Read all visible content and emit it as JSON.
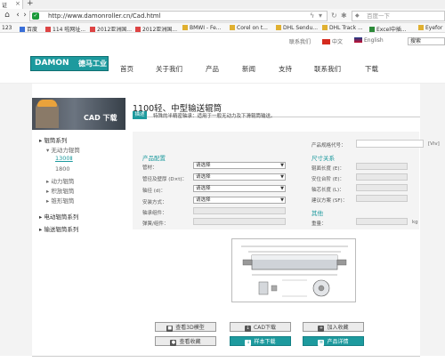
{
  "browser": {
    "tab_title": "证",
    "tab_close": "×",
    "new_tab": "+",
    "url": "http://www.damonroller.cn/Cad.html",
    "search_placeholder": "百度一下",
    "bookmarks": [
      "123",
      "百度",
      "114 啦网址...",
      "2012亚洲国...",
      "2012亚洲国...",
      "BMWI - Fe...",
      "Corel on t...",
      "DHL Sendu...",
      "DHL Track ...",
      "Excel中插...",
      "Eyefor"
    ]
  },
  "site": {
    "top_links": {
      "favorite": "联系我们",
      "cn": "中文",
      "en": "English",
      "search": "搜索"
    },
    "logo_text": "DAMON",
    "logo_cn": "德马工业",
    "menu": [
      "首页",
      "关于我们",
      "产品",
      "新闻",
      "支持",
      "联系我们",
      "下载"
    ]
  },
  "sidebar": {
    "banner": "CAD 下载",
    "items": [
      {
        "label": "辊筒系列"
      },
      {
        "label": "无动力辊筒"
      },
      {
        "label": "1300Ⅱ"
      },
      {
        "label": "1800"
      },
      {
        "label": "动力辊筒"
      },
      {
        "label": "积放辊筒"
      },
      {
        "label": "锥形辊筒"
      },
      {
        "label": "电动辊筒系列"
      },
      {
        "label": "输送辊筒系列"
      }
    ]
  },
  "product": {
    "title": "1100轻、中型输送辊筒",
    "tag": "描述",
    "feature": "特殊的半精密轴承：适用于一般无动力及下滑辊筒输送。",
    "config_title": "产品配置",
    "size_title": "尺寸关系",
    "other_title": "其他",
    "model_label": "产品规格代号：",
    "model_unit": "[Viv]",
    "left_fields": [
      "管材：",
      "管径及壁厚 (D×t)：",
      "轴径 (d)：",
      "安装方式："
    ],
    "select_value": "请选择",
    "left_inputs": [
      "轴承组件：",
      "弹簧/组件："
    ],
    "right_fields": [
      "辊面长度 (E)：",
      "安位台阶 (E)：",
      "轴芯长度 (L)：",
      "建议方案 (SF)："
    ],
    "weight_label": "重量：",
    "weight_unit": "kg"
  },
  "buttons": [
    {
      "label": "查看3D模型",
      "icon": "cube-icon"
    },
    {
      "label": "CAD下载",
      "icon": "download-icon"
    },
    {
      "label": "加入收藏",
      "icon": "plus-icon"
    },
    {
      "label": "查看收藏",
      "icon": "eye-icon"
    },
    {
      "label": "样本下载",
      "icon": "download-icon"
    },
    {
      "label": "产品详情",
      "icon": "list-icon"
    }
  ],
  "colors": {
    "accent": "#1d9a9e"
  }
}
